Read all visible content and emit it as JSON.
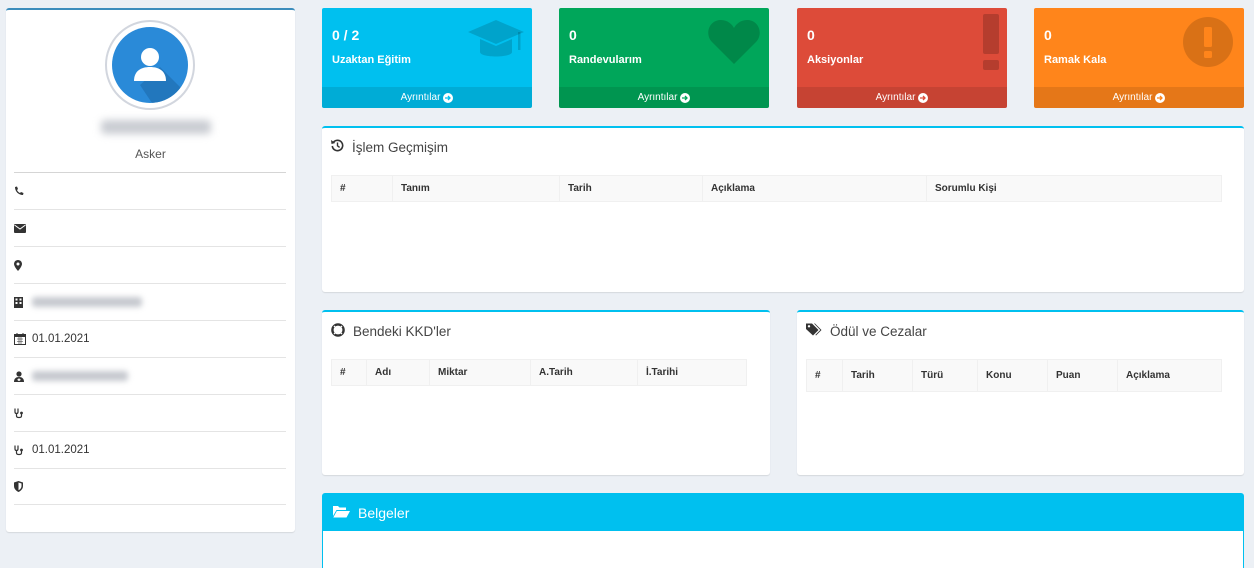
{
  "profile": {
    "role": "Asker",
    "rows": [
      {
        "icon": "phone-icon",
        "value": ""
      },
      {
        "icon": "envelope-icon",
        "value": ""
      },
      {
        "icon": "map-marker-icon",
        "value": ""
      },
      {
        "icon": "building-icon",
        "value": ""
      },
      {
        "icon": "calendar-icon",
        "value": "01.01.2021"
      },
      {
        "icon": "user-doctor-icon",
        "value": ""
      },
      {
        "icon": "stethoscope-icon",
        "value": ""
      },
      {
        "icon": "stethoscope-icon",
        "value": "01.01.2021"
      },
      {
        "icon": "shield-icon",
        "value": ""
      }
    ]
  },
  "stats": [
    {
      "value": "0 / 2",
      "label": "Uzaktan Eğitim",
      "footer": "Ayrıntılar",
      "color": "#00c0ef",
      "icon": "graduation-cap-icon"
    },
    {
      "value": "0",
      "label": "Randevularım",
      "footer": "Ayrıntılar",
      "color": "#00a65a",
      "icon": "heart-icon"
    },
    {
      "value": "0",
      "label": "Aksiyonlar",
      "footer": "Ayrıntılar",
      "color": "#dd4b39",
      "icon": "exclamation-icon"
    },
    {
      "value": "0",
      "label": "Ramak Kala",
      "footer": "Ayrıntılar",
      "color": "#ff851b",
      "icon": "exclamation-circle-icon"
    }
  ],
  "history": {
    "title": "İşlem Geçmişim",
    "columns": [
      "#",
      "Tanım",
      "Tarih",
      "Açıklama",
      "Sorumlu Kişi"
    ]
  },
  "kkd": {
    "title": "Bendeki KKD'ler",
    "columns": [
      "#",
      "Adı",
      "Miktar",
      "A.Tarih",
      "İ.Tarihi"
    ]
  },
  "awards": {
    "title": "Ödül ve Cezalar",
    "columns": [
      "#",
      "Tarih",
      "Türü",
      "Konu",
      "Puan",
      "Açıklama"
    ]
  },
  "documents": {
    "title": "Belgeler"
  }
}
